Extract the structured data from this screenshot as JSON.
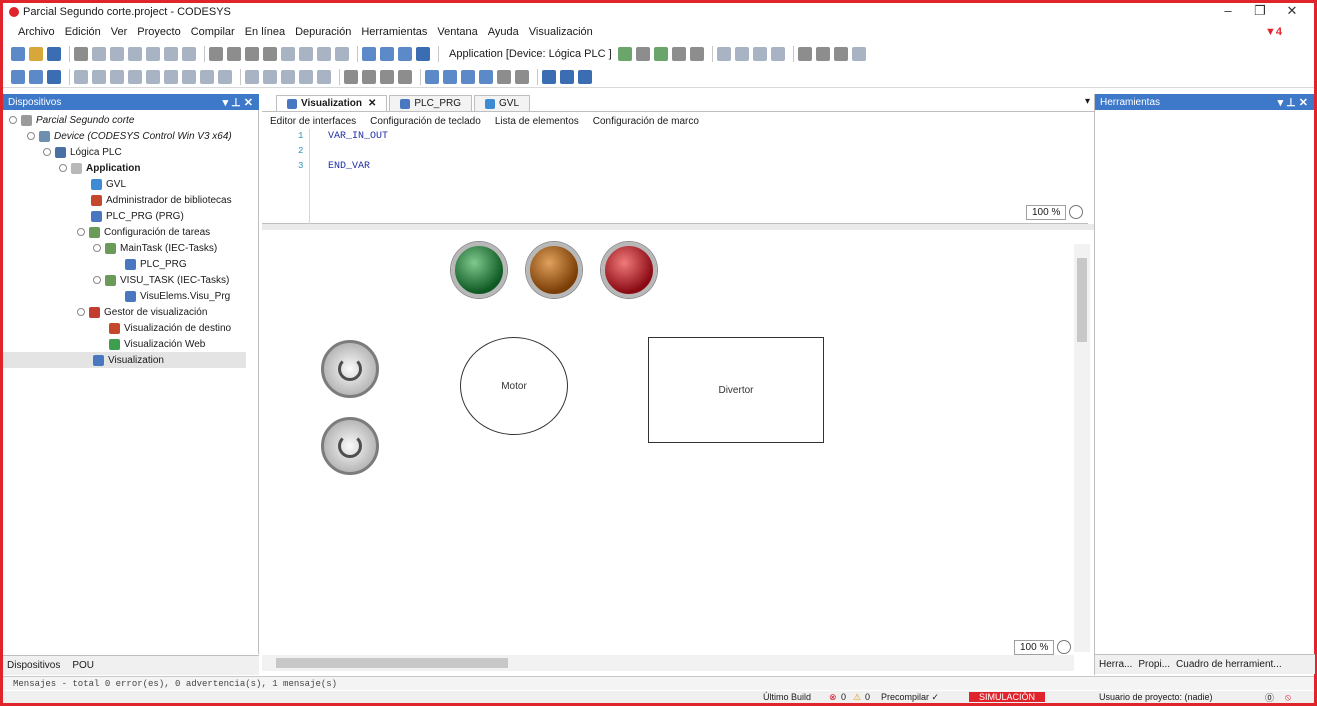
{
  "window": {
    "title": "Parcial Segundo corte.project - CODESYS",
    "flag_count": "4"
  },
  "menu": [
    "Archivo",
    "Edición",
    "Ver",
    "Proyecto",
    "Compilar",
    "En línea",
    "Depuración",
    "Herramientas",
    "Ventana",
    "Ayuda",
    "Visualización"
  ],
  "toolbar": {
    "application_selector": "Application [Device: Lógica PLC ]"
  },
  "devices": {
    "title": "Dispositivos",
    "tree": [
      "Parcial Segundo corte",
      "Device (CODESYS Control Win V3 x64)",
      "Lógica PLC",
      "Application",
      "GVL",
      "Administrador de bibliotecas",
      "PLC_PRG (PRG)",
      "Configuración de tareas",
      "MainTask (IEC-Tasks)",
      "PLC_PRG",
      "VISU_TASK (IEC-Tasks)",
      "VisuElems.Visu_Prg",
      "Gestor de visualización",
      "Visualización de destino",
      "Visualización Web",
      "Visualization"
    ],
    "bottom_tabs": [
      "Dispositivos",
      "POU"
    ]
  },
  "editor": {
    "tabs": [
      "Visualization",
      "PLC_PRG",
      "GVL"
    ],
    "subtabs": [
      "Editor de interfaces",
      "Configuración de teclado",
      "Lista de elementos",
      "Configuración de marco"
    ],
    "code_lines": [
      {
        "num": "1",
        "text": "VAR_IN_OUT"
      },
      {
        "num": "2",
        "text": ""
      },
      {
        "num": "3",
        "text": "END_VAR"
      }
    ],
    "zoom_top": "100 %",
    "zoom_bottom": "100 %",
    "canvas": {
      "motor_label": "Motor",
      "divertor_label": "Divertor"
    }
  },
  "tools": {
    "title": "Herramientas",
    "bottom_tabs": [
      "Herra...",
      "Propi...",
      "Cuadro de herramient..."
    ]
  },
  "messages": "Mensajes - total 0 error(es), 0 advertencia(s), 1 mensaje(s)",
  "status": {
    "last_build": "Último Build",
    "errors": "0",
    "warnings": "0",
    "precompile": "Precompilar ✓",
    "simulation": "SIMULACIÓN",
    "project_user": "Usuario de proyecto: (nadie)"
  }
}
